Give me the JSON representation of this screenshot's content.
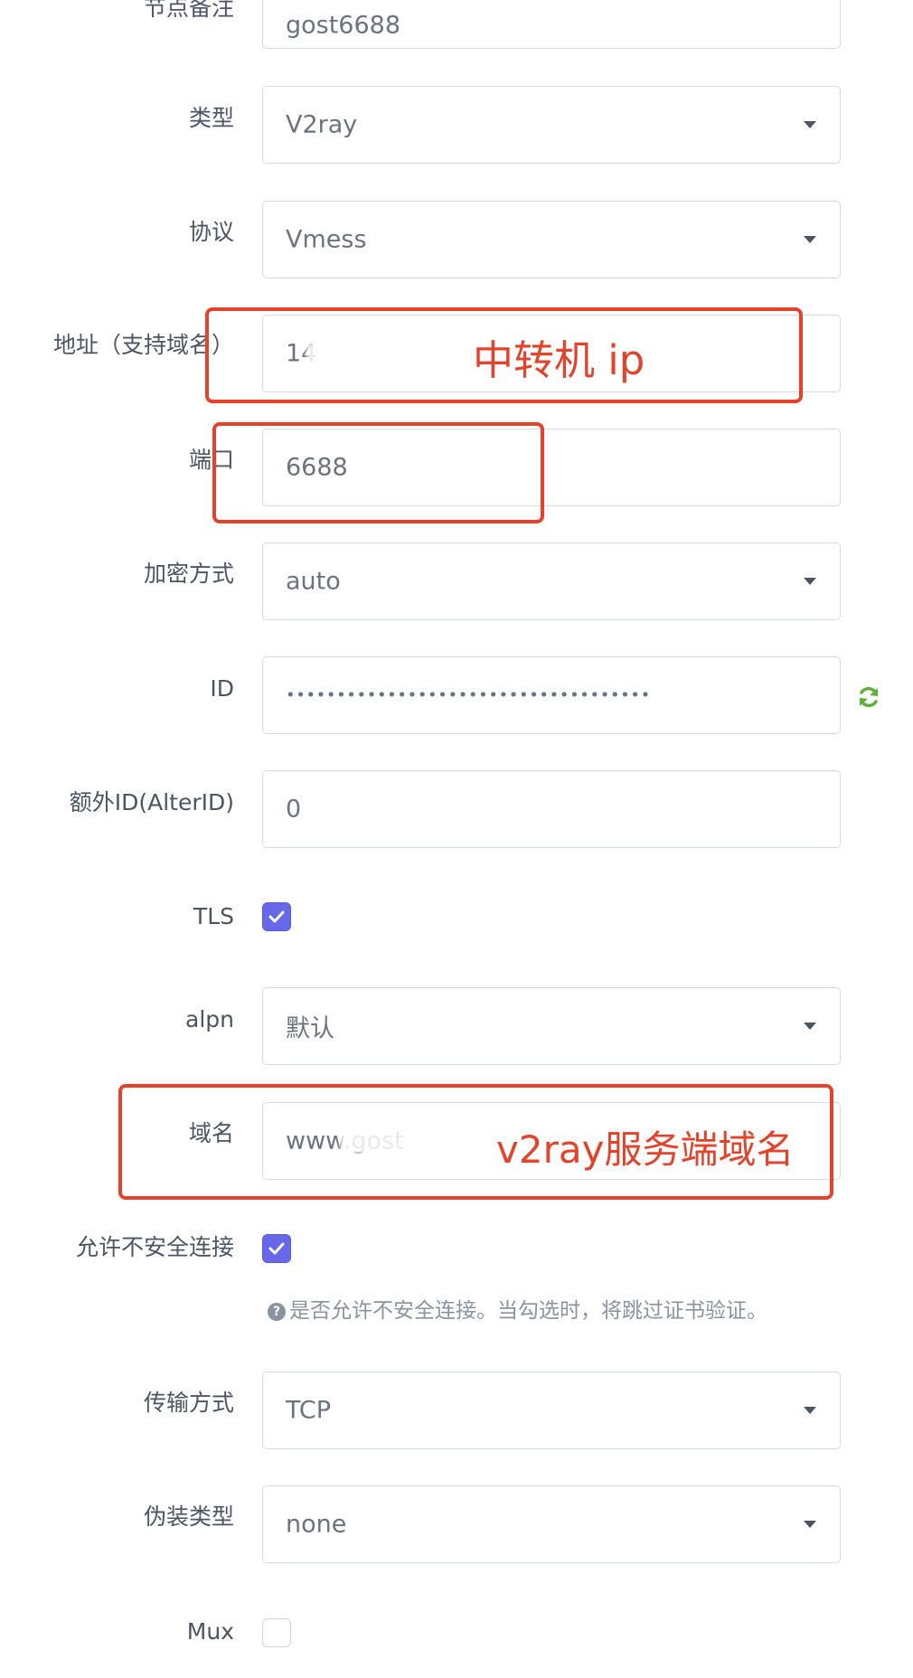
{
  "form": {
    "remark": {
      "label": "节点备注",
      "value": "gost6688"
    },
    "type": {
      "label": "类型",
      "value": "V2ray"
    },
    "protocol": {
      "label": "协议",
      "value": "Vmess"
    },
    "address": {
      "label": "地址（支持域名）",
      "value": "14"
    },
    "port": {
      "label": "端口",
      "value": "6688"
    },
    "encryption": {
      "label": "加密方式",
      "value": "auto"
    },
    "id": {
      "label": "ID",
      "value": "••••••••••••••••••••••••••••••••••••"
    },
    "alter_id": {
      "label": "额外ID(AlterID)",
      "value": "0"
    },
    "tls": {
      "label": "TLS",
      "checked": true
    },
    "alpn": {
      "label": "alpn",
      "value": "默认"
    },
    "domain": {
      "label": "域名",
      "value": "www.gost"
    },
    "allow_insecure": {
      "label": "允许不安全连接",
      "checked": true,
      "help": "是否允许不安全连接。当勾选时，将跳过证书验证。"
    },
    "transport": {
      "label": "传输方式",
      "value": "TCP"
    },
    "camouflage": {
      "label": "伪装类型",
      "value": "none"
    },
    "mux": {
      "label": "Mux",
      "checked": false
    }
  },
  "annotations": {
    "relay_ip": "中转机 ip",
    "server_domain": "v2ray服务端域名"
  },
  "icons": {
    "refresh": "refresh-icon",
    "help": "question-circle-icon",
    "dropdown": "caret-down-icon",
    "check": "checkmark-icon"
  },
  "colors": {
    "accent": "#6768e8",
    "annotation": "#e2432a",
    "refresh": "#5fae3a"
  }
}
